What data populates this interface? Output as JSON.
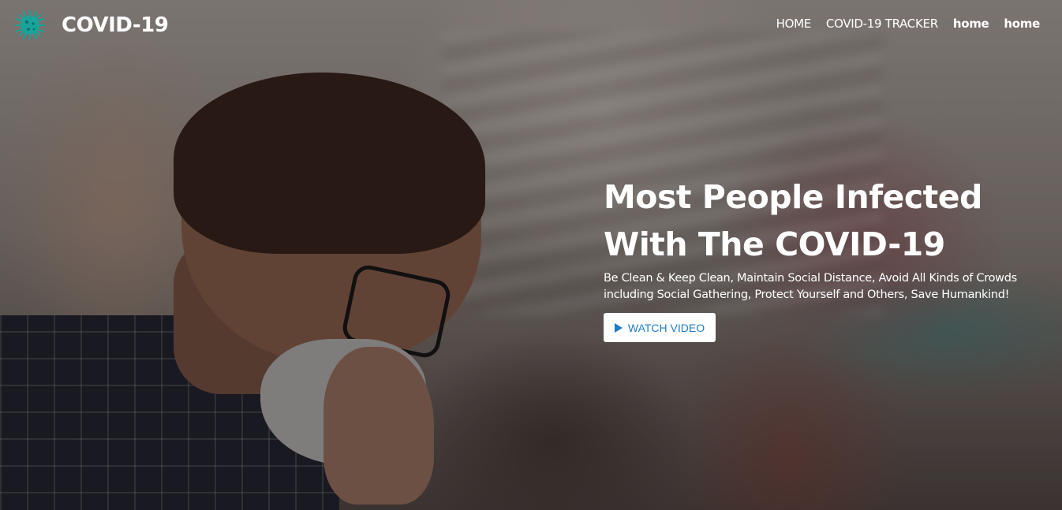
{
  "brand": {
    "name": "COVID-19",
    "logo_icon": "virus-icon",
    "logo_color": "#1aa39a"
  },
  "nav": {
    "items": [
      {
        "label": "HOME"
      },
      {
        "label": "COVID-19 TRACKER"
      },
      {
        "label": "home"
      },
      {
        "label": "home"
      }
    ]
  },
  "hero": {
    "title_line1": "Most People Infected",
    "title_line2": "With The COVID-19",
    "subtitle_line1": "Be Clean & Keep Clean, Maintain Social Distance, Avoid All Kinds of Crowds",
    "subtitle_line2": "including Social Gathering, Protect Yourself and Others, Save Humankind!",
    "button_label": "WATCH VIDEO",
    "button_icon": "play-icon",
    "button_text_color": "#1f7bc4"
  }
}
